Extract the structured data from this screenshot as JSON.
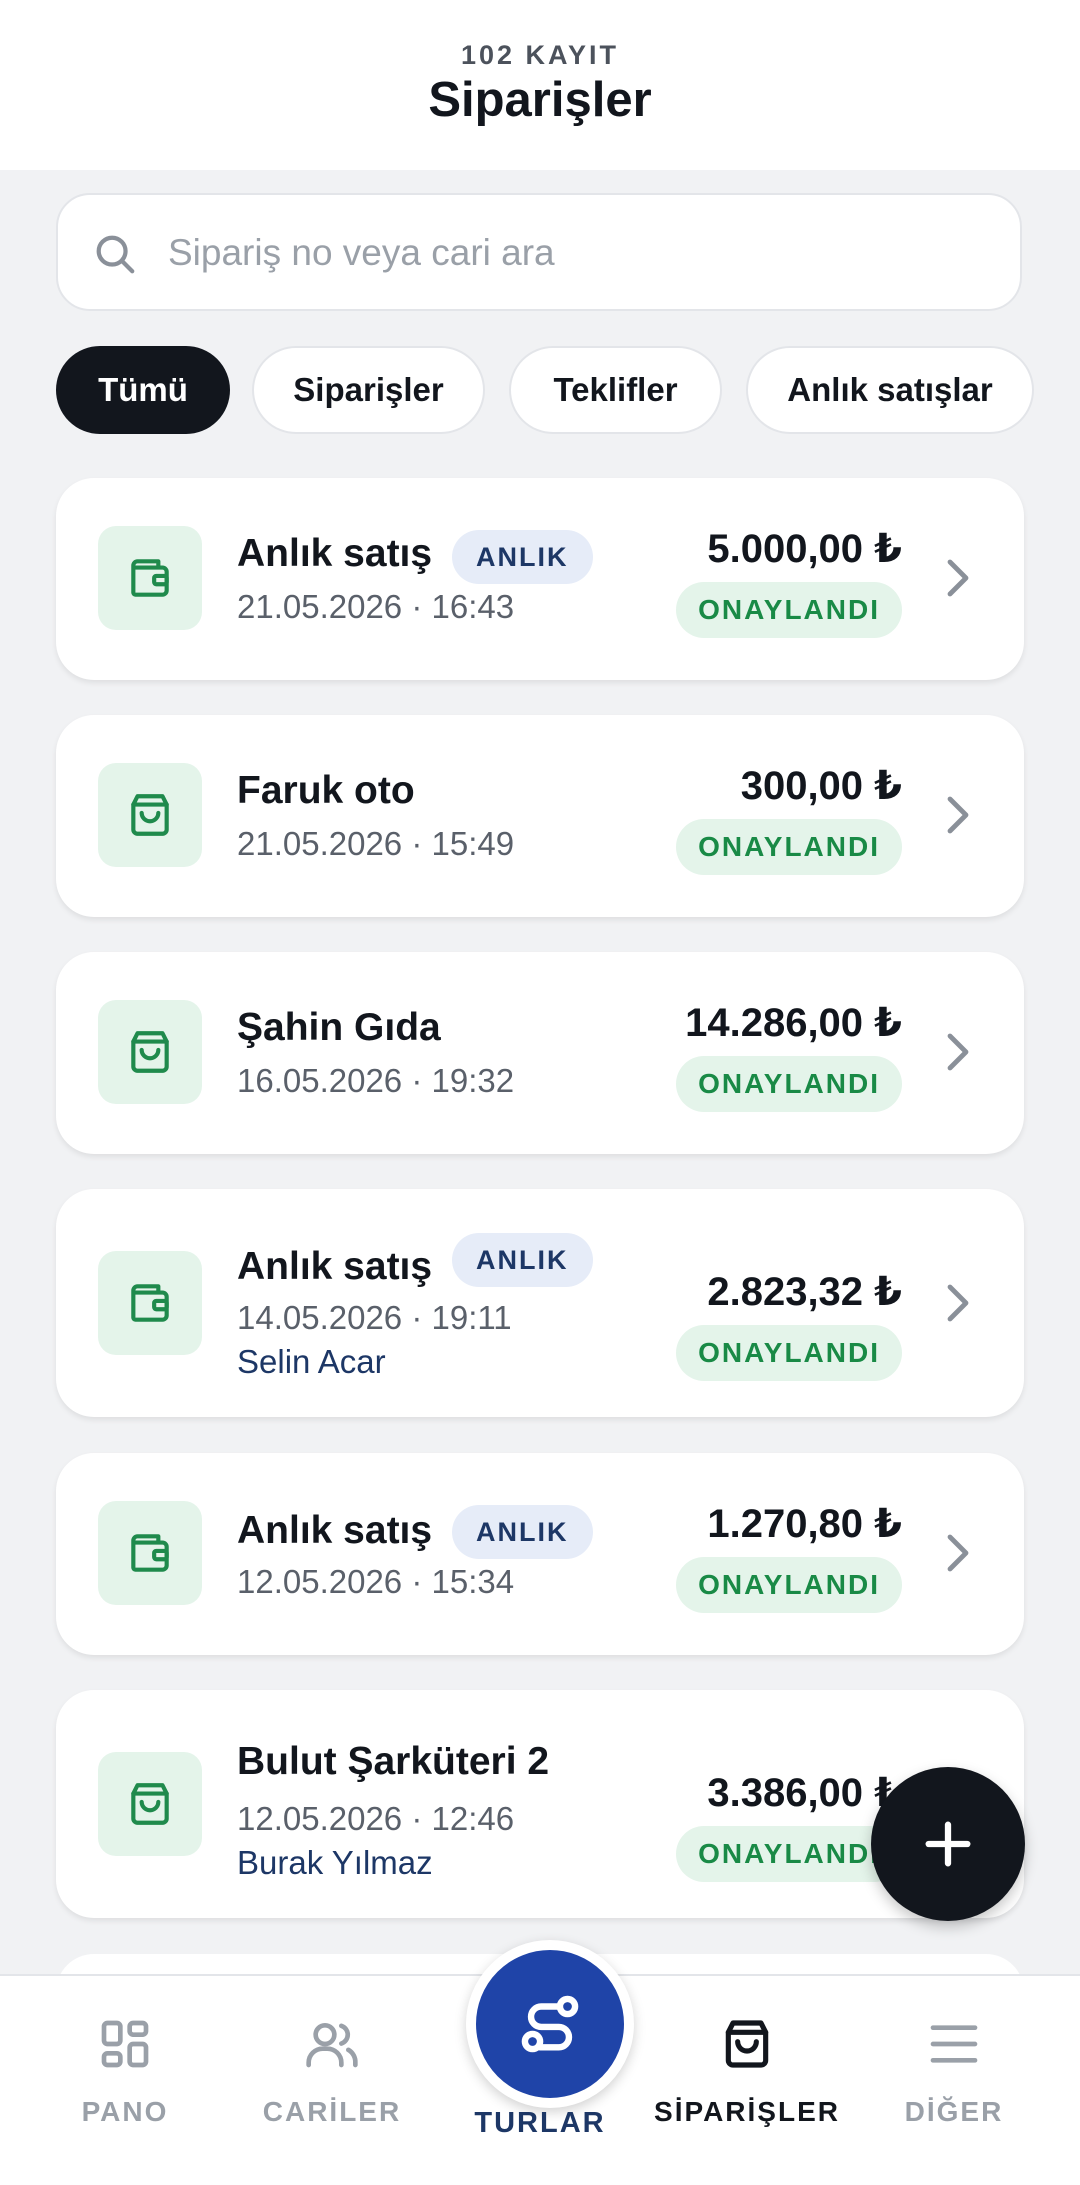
{
  "header": {
    "count": "102 KAYIT",
    "title": "Siparişler"
  },
  "search": {
    "placeholder": "Sipariş no veya cari ara"
  },
  "filters": [
    "Tümü",
    "Siparişler",
    "Teklifler",
    "Anlık satışlar"
  ],
  "orders": [
    {
      "name": "Anlık satış",
      "tag": "ANLIK",
      "date": "21.05.2026 · 16:43",
      "amount": "5.000,00 ₺",
      "status": "ONAYLANDI",
      "icon": "wallet-icon"
    },
    {
      "name": "Faruk oto",
      "date": "21.05.2026 · 15:49",
      "amount": "300,00 ₺",
      "status": "ONAYLANDI",
      "icon": "shopping-bag-icon"
    },
    {
      "name": "Şahin Gıda",
      "date": "16.05.2026 · 19:32",
      "amount": "14.286,00 ₺",
      "status": "ONAYLANDI",
      "icon": "shopping-bag-icon"
    },
    {
      "name": "Anlık satış",
      "tag": "ANLIK",
      "date": "14.05.2026 · 19:11",
      "person": "Selin Acar",
      "amount": "2.823,32 ₺",
      "status": "ONAYLANDI",
      "icon": "wallet-icon"
    },
    {
      "name": "Anlık satış",
      "tag": "ANLIK",
      "date": "12.05.2026 · 15:34",
      "amount": "1.270,80 ₺",
      "status": "ONAYLANDI",
      "icon": "wallet-icon"
    },
    {
      "name": "Bulut Şarküteri 2",
      "date": "12.05.2026 · 12:46",
      "person": "Burak Yılmaz",
      "amount": "3.386,00 ₺",
      "status": "ONAYLANDI",
      "icon": "shopping-bag-icon"
    }
  ],
  "nav": {
    "pano": "PANO",
    "cariler": "CARİLER",
    "turlar": "TURLAR",
    "siparisler": "SİPARİŞLER",
    "diger": "DİĞER"
  },
  "colors": {
    "accent": "#1f44a8",
    "success": "#198a46",
    "dark": "#12161d"
  }
}
